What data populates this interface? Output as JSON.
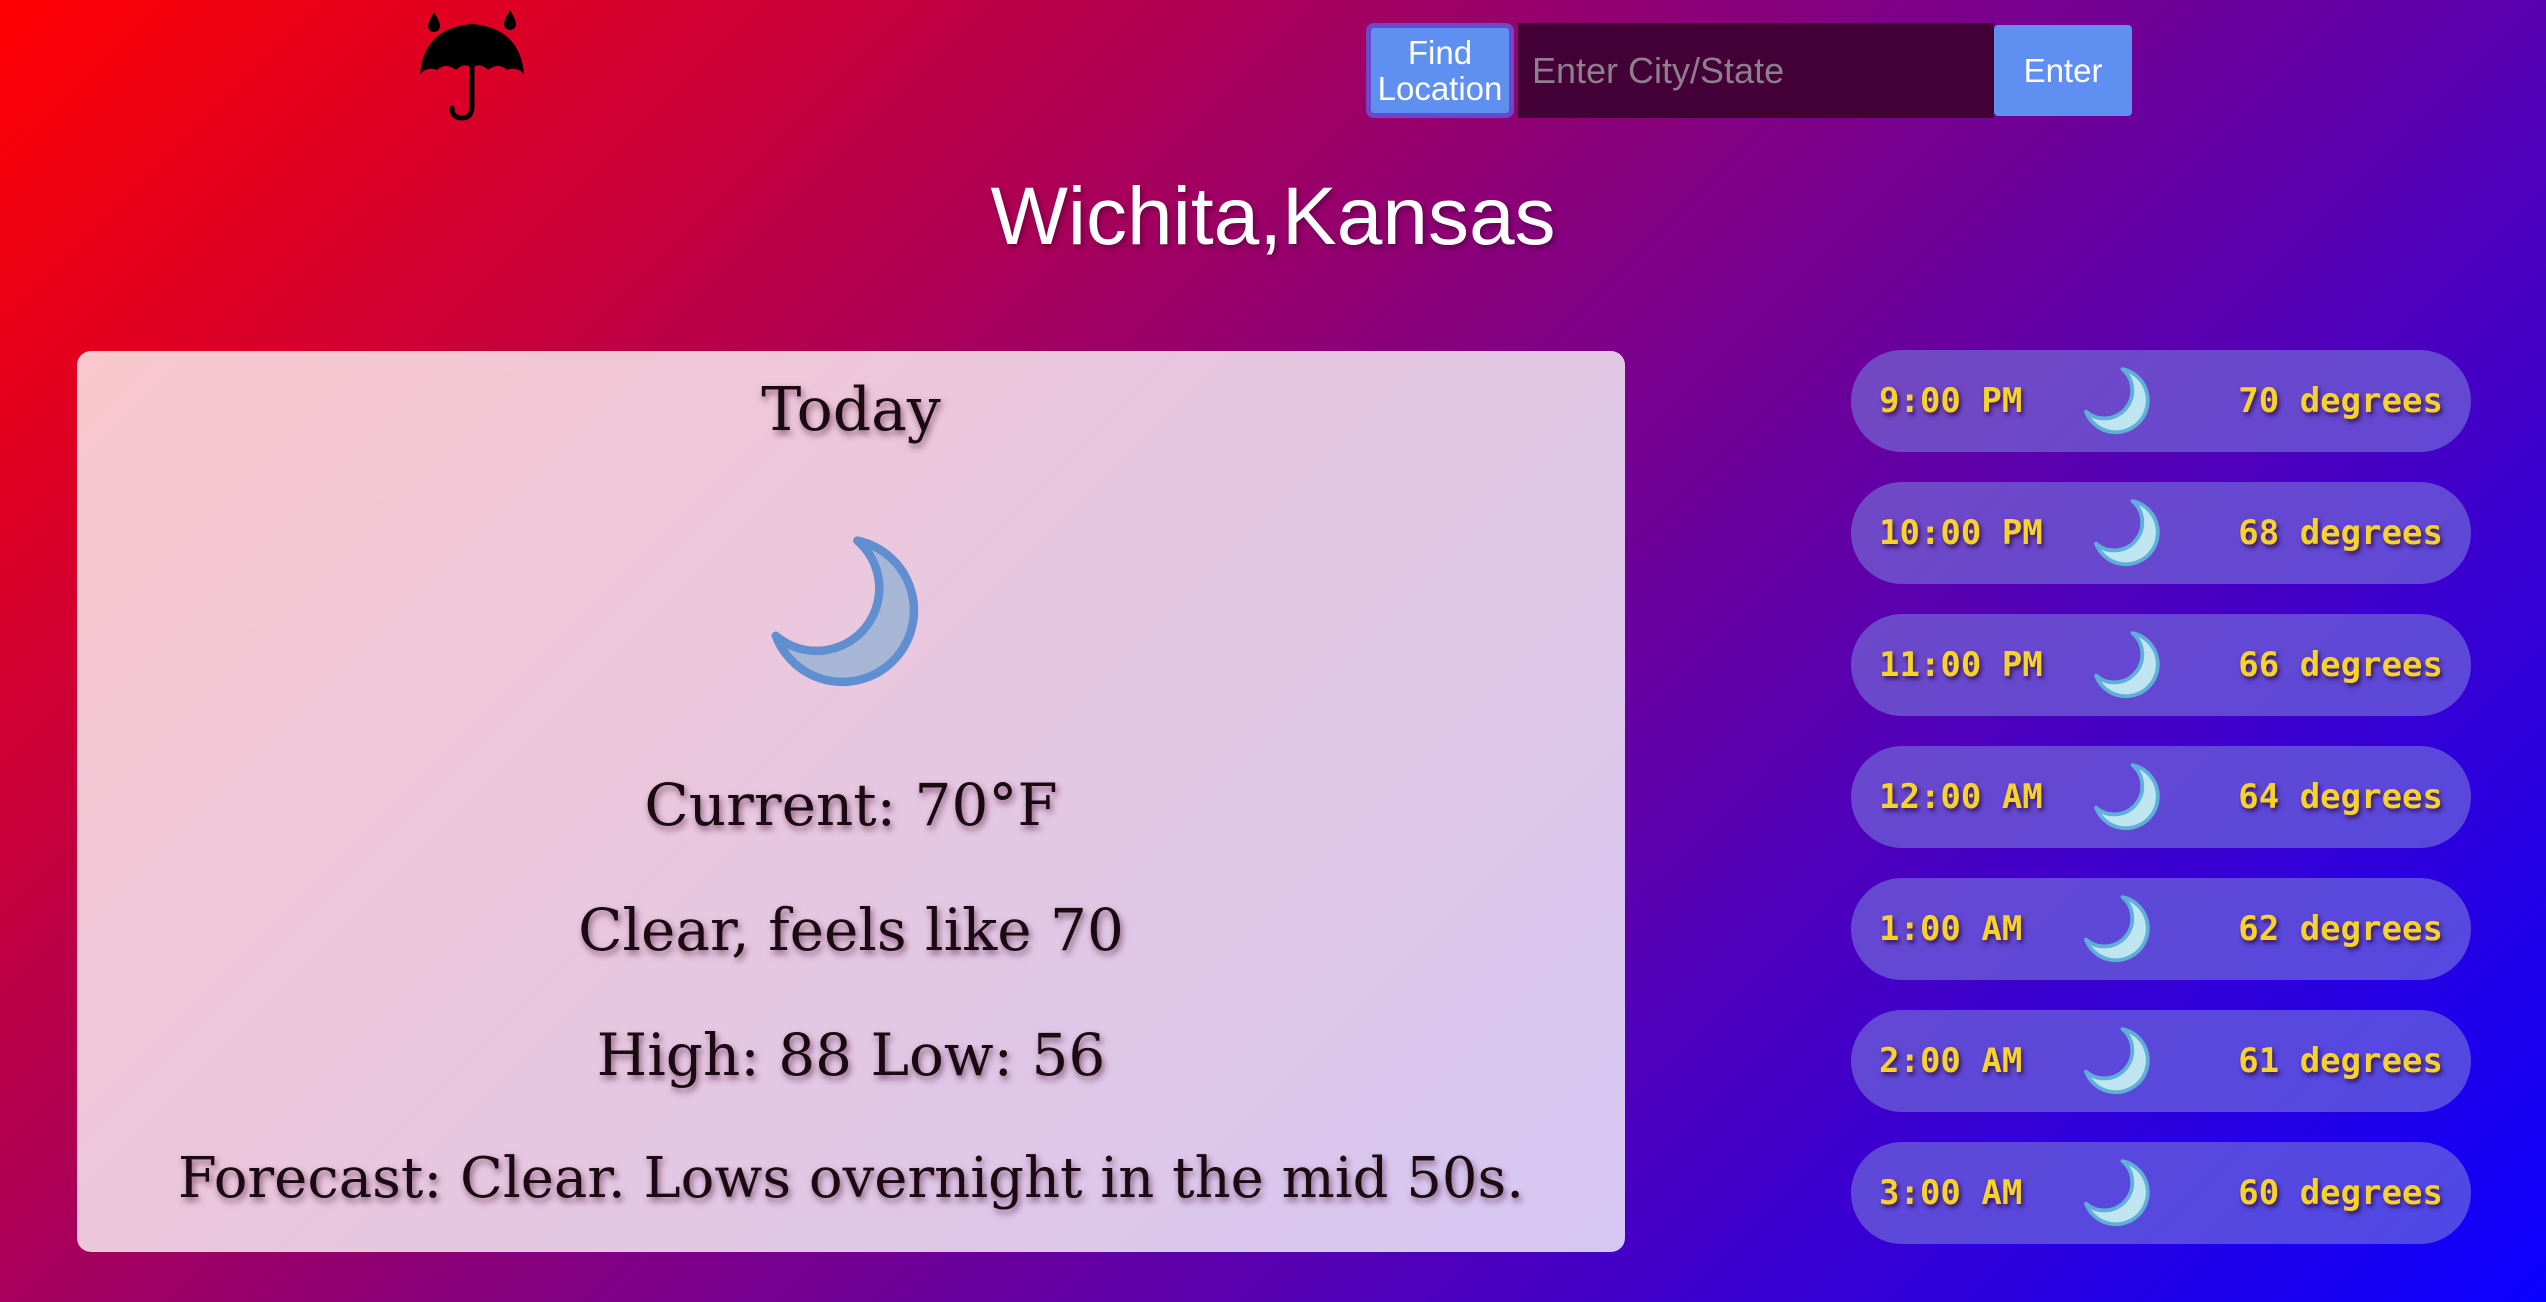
{
  "header": {
    "logo_icon": "umbrella-rain-icon"
  },
  "search": {
    "find_location_label": "Find Location",
    "placeholder": "Enter City/State",
    "value": "",
    "enter_label": "Enter"
  },
  "location": {
    "title": "Wichita,Kansas"
  },
  "today": {
    "heading": "Today",
    "icon": "moon-icon",
    "current": "Current: 70°F",
    "conditions": "Clear, feels like 70",
    "high_low": "High: 88 Low: 56",
    "forecast": "Forecast: Clear. Lows overnight in the mid 50s."
  },
  "hourly": [
    {
      "time": "9:00 PM",
      "icon": "moon-icon",
      "temp": "70 degrees"
    },
    {
      "time": "10:00 PM",
      "icon": "moon-icon",
      "temp": "68 degrees"
    },
    {
      "time": "11:00 PM",
      "icon": "moon-icon",
      "temp": "66 degrees"
    },
    {
      "time": "12:00 AM",
      "icon": "moon-icon",
      "temp": "64 degrees"
    },
    {
      "time": "1:00 AM",
      "icon": "moon-icon",
      "temp": "62 degrees"
    },
    {
      "time": "2:00 AM",
      "icon": "moon-icon",
      "temp": "61 degrees"
    },
    {
      "time": "3:00 AM",
      "icon": "moon-icon",
      "temp": "60 degrees"
    }
  ],
  "colors": {
    "button_blue": "#5f8ff0",
    "input_bg": "#430036",
    "hourly_text": "#f6d22c",
    "gradient_start": "#ff0000",
    "gradient_end": "#0a00ff"
  }
}
